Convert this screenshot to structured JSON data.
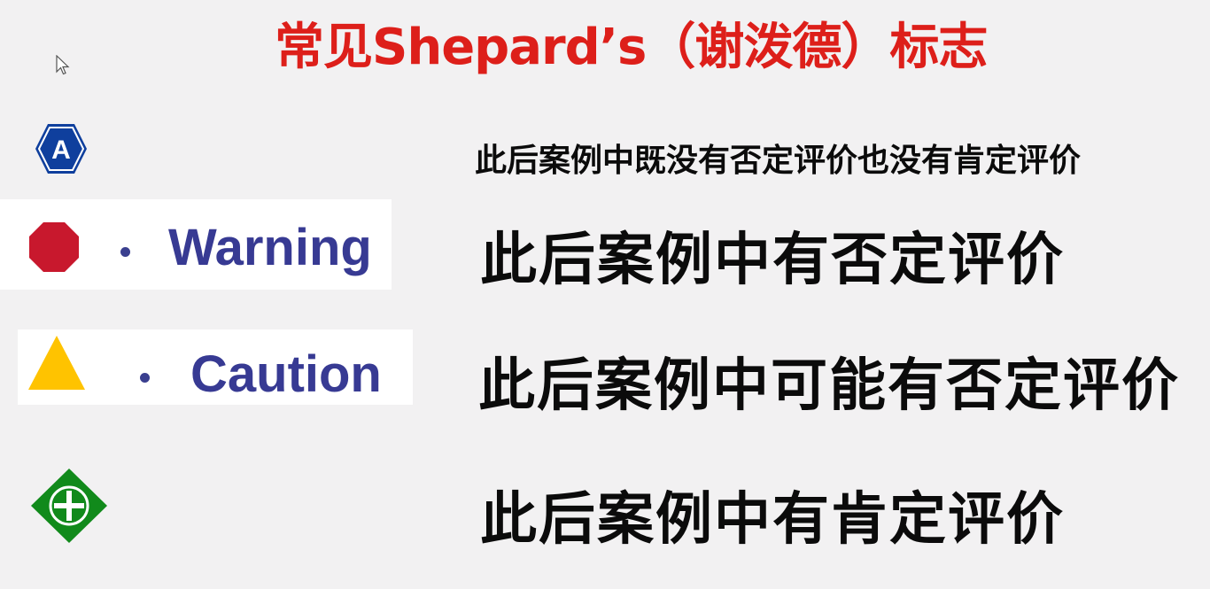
{
  "title": "常见Shepard’s（谢泼德）标志",
  "colors": {
    "title": "#dd1f1a",
    "label_text": "#373a93",
    "analysis_icon": "#0f3f9d",
    "warning_icon": "#c8182d",
    "caution_icon": "#ffc300",
    "positive_icon": "#118a1b"
  },
  "rows": [
    {
      "icon": "analysis-hexagon-a-icon",
      "icon_letter": "A",
      "label": "",
      "description": "此后案例中既没有否定评价也没有肯定评价"
    },
    {
      "icon": "red-octagon-stop-icon",
      "label": "Warning",
      "description": "此后案例中有否定评价"
    },
    {
      "icon": "yellow-triangle-icon",
      "label": "Caution",
      "description": "此后案例中可能有否定评价"
    },
    {
      "icon": "green-diamond-plus-icon",
      "label": "",
      "description": "此后案例中有肯定评价"
    }
  ]
}
